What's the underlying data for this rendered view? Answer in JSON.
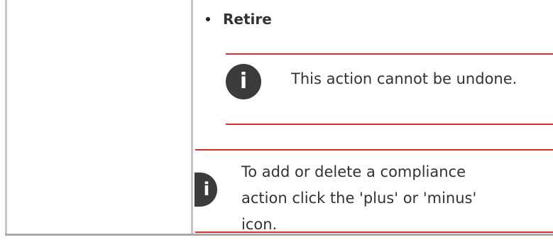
{
  "list": {
    "items": [
      {
        "label": "Retire"
      }
    ]
  },
  "notes": [
    {
      "icon": "info-icon",
      "text": "This action cannot be undone."
    },
    {
      "icon": "info-icon",
      "lines": [
        "To add or delete a compliance",
        "action click the 'plus' or 'minus'",
        "icon."
      ]
    }
  ],
  "colors": {
    "note_border": "#d9302b",
    "icon_background": "#3b3b3b",
    "table_border": "#c6c6c6"
  }
}
